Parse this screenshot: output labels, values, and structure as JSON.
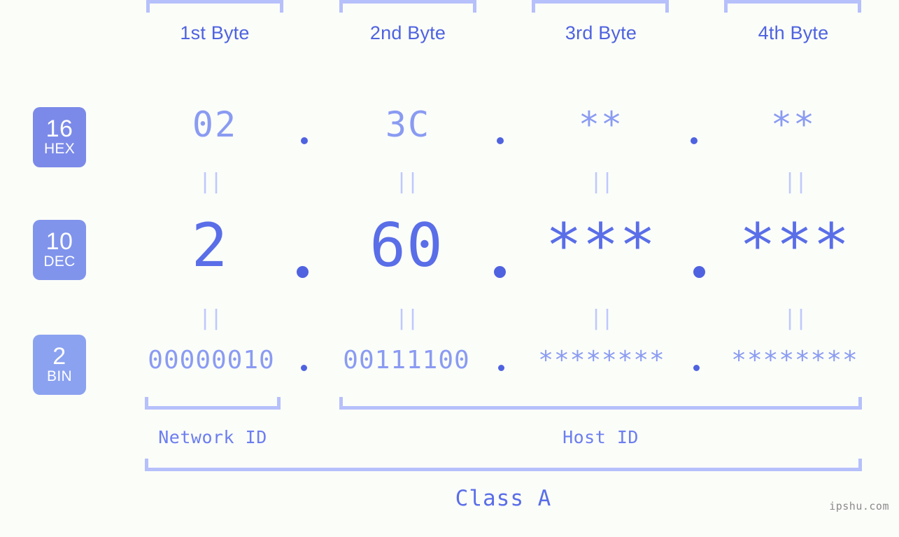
{
  "watermark": "ipshu.com",
  "headers": [
    {
      "label": "1st Byte"
    },
    {
      "label": "2nd Byte"
    },
    {
      "label": "3rd Byte"
    },
    {
      "label": "4th Byte"
    }
  ],
  "bases": [
    {
      "number": "16",
      "abbr": "HEX"
    },
    {
      "number": "10",
      "abbr": "DEC"
    },
    {
      "number": "2",
      "abbr": "BIN"
    }
  ],
  "rows": {
    "hex": {
      "base": "16",
      "abbr": "HEX",
      "values": [
        "02",
        "3C",
        "**",
        "**"
      ]
    },
    "dec": {
      "base": "10",
      "abbr": "DEC",
      "values": [
        "2",
        "60",
        "***",
        "***"
      ]
    },
    "bin": {
      "base": "2",
      "abbr": "BIN",
      "values": [
        "00000010",
        "00111100",
        "********",
        "********"
      ]
    }
  },
  "separator": ".",
  "equality_mark": "||",
  "footer": {
    "network_id": "Network ID",
    "host_id": "Host ID",
    "class": "Class A"
  },
  "colors": {
    "background": "#fbfdf9",
    "accent_dark": "#4f63e0",
    "accent_mid": "#5a6ee8",
    "accent_light": "#8a9bf2",
    "bracket": "#b6c0fb",
    "badge_hex": "#7b8ae8",
    "badge_dec": "#8094ec",
    "badge_bin": "#8ba2f0",
    "watermark": "#8b8b8b"
  }
}
